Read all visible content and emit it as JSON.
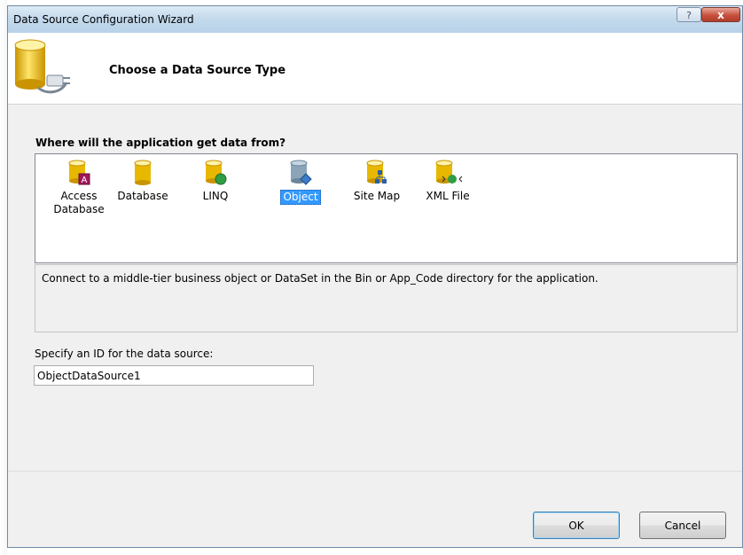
{
  "window": {
    "title": "Data Source Configuration Wizard",
    "help_glyph": "?",
    "close_glyph": "x"
  },
  "header": {
    "title": "Choose a Data Source Type",
    "icon": "database-plug-icon"
  },
  "main": {
    "question": "Where will the application get data from?",
    "types": [
      {
        "label": "Access Database",
        "icon": "access-database-icon",
        "selected": false
      },
      {
        "label": "Database",
        "icon": "database-icon",
        "selected": false
      },
      {
        "label": "LINQ",
        "icon": "linq-icon",
        "selected": false
      },
      {
        "label": "Object",
        "icon": "object-icon",
        "selected": true
      },
      {
        "label": "Site Map",
        "icon": "site-map-icon",
        "selected": false
      },
      {
        "label": "XML File",
        "icon": "xml-file-icon",
        "selected": false
      }
    ],
    "description": "Connect to a middle-tier business object or DataSet in the Bin or App_Code directory for the application.",
    "id_label": "Specify an ID for the data source:",
    "id_value": "ObjectDataSource1"
  },
  "footer": {
    "ok_label": "OK",
    "cancel_label": "Cancel"
  },
  "colors": {
    "selection": "#3399ff",
    "cylinder": "#e8b800",
    "close": "#c8503d"
  }
}
